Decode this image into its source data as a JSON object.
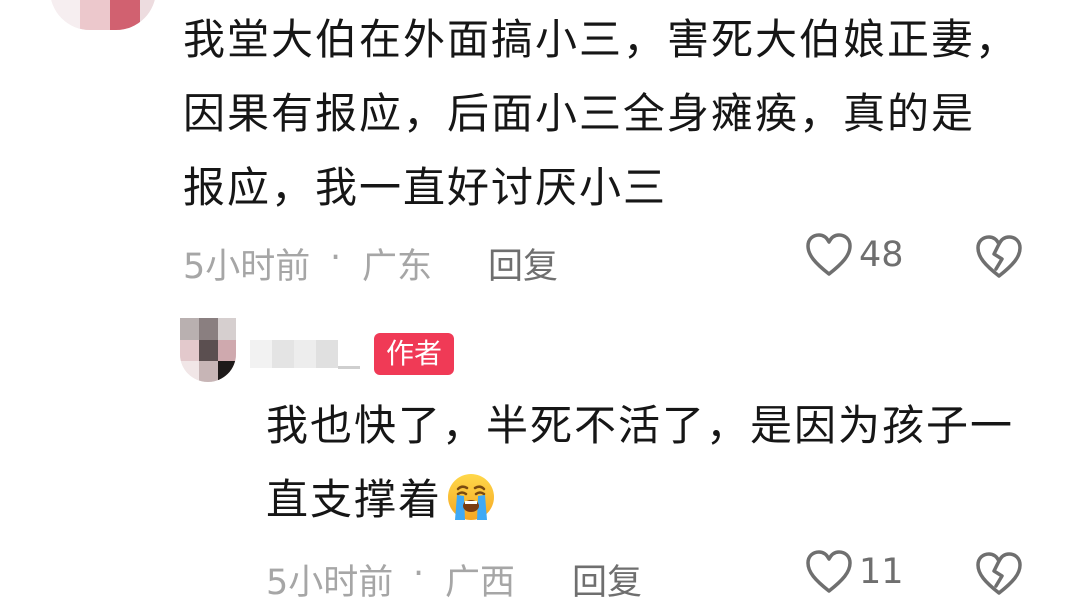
{
  "comment": {
    "lines": [
      "我堂大伯在外面搞小三，害死大伯娘正妻，",
      "因果有报应，后面小三全身瘫痪，真的是",
      "报应，我一直好讨厌小三"
    ],
    "time": "5小时前",
    "separator": "·",
    "location": "广东",
    "reply_label": "回复",
    "like_count": "48"
  },
  "reply": {
    "author_badge": "作者",
    "lines": [
      "我也快了，半死不活了，是因为孩子一",
      "直支撑着"
    ],
    "emoji": "loudly-crying-face",
    "time": "5小时前",
    "separator": "·",
    "location": "广西",
    "reply_label": "回复",
    "like_count": "11"
  },
  "colors": {
    "text": "#161616",
    "meta": "#a6a6a6",
    "action": "#6f6f6f",
    "badge": "#f03a56"
  }
}
